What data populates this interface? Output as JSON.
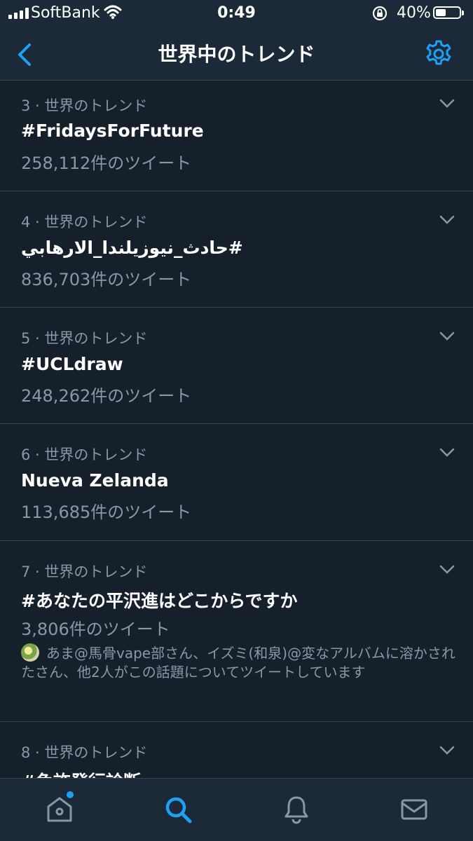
{
  "status_bar": {
    "carrier": "SoftBank",
    "time": "0:49",
    "battery": "40%",
    "battery_level": 0.4
  },
  "header": {
    "title": "世界中のトレンド",
    "back_icon": "chevron-left-icon",
    "settings_icon": "gear-icon"
  },
  "trends": [
    {
      "rank_label": "3 · 世界のトレンド",
      "name": "#FridaysForFuture",
      "count": "258,112件のツイート"
    },
    {
      "rank_label": "4 · 世界のトレンド",
      "name": "#حادث_نيوزيلندا_الارهابي",
      "count": "836,703件のツイート"
    },
    {
      "rank_label": "5 · 世界のトレンド",
      "name": "#UCLdraw",
      "count": "248,262件のツイート"
    },
    {
      "rank_label": "6 · 世界のトレンド",
      "name": "Nueva Zelanda",
      "count": "113,685件のツイート"
    },
    {
      "rank_label": "7 · 世界のトレンド",
      "name": "#あなたの平沢進はどこからですか",
      "count": "3,806件のツイート",
      "context": "あま@馬骨vape部さん、イズミ(和泉)@変なアルバムに溶かされたさん、他2人がこの話題についてツイートしています"
    },
    {
      "rank_label": "8 · 世界のトレンド",
      "name": "#免許発行診断",
      "count": ""
    }
  ],
  "tab_bar": {
    "tabs": [
      "home-icon",
      "search-icon",
      "notifications-icon",
      "messages-icon"
    ],
    "active": "search-icon",
    "accent": "#1da1f2",
    "inactive": "#8899a6"
  }
}
